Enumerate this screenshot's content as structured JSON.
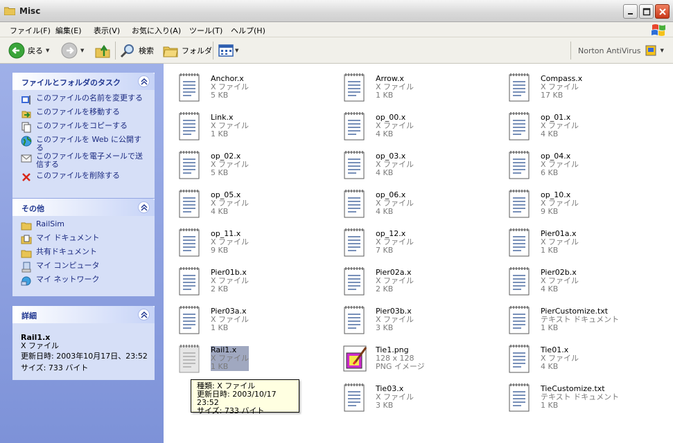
{
  "window": {
    "title": "Misc"
  },
  "menu": [
    "ファイル(F)",
    "編集(E)",
    "表示(V)",
    "お気に入り(A)",
    "ツール(T)",
    "ヘルプ(H)"
  ],
  "toolbar": {
    "back": "戻る",
    "search": "検索",
    "folders": "フォルダ",
    "norton": "Norton AntiVirus"
  },
  "tasks": {
    "title": "ファイルとフォルダのタスク",
    "items": [
      "このファイルの名前を変更する",
      "このファイルを移動する",
      "このファイルをコピーする",
      "このファイルを Web に公開する",
      "このファイルを電子メールで送信する",
      "このファイルを削除する"
    ]
  },
  "other": {
    "title": "その他",
    "items": [
      "RailSim",
      "マイ ドキュメント",
      "共有ドキュメント",
      "マイ コンピュータ",
      "マイ ネットワーク"
    ]
  },
  "details": {
    "title": "詳細",
    "name": "Rail1.x",
    "type": "X ファイル",
    "modified": "更新日時: 2003年10月17日、23:52",
    "size": "サイズ: 733 バイト"
  },
  "files": [
    {
      "name": "Anchor.x",
      "type": "X ファイル",
      "size": "5 KB"
    },
    {
      "name": "Arrow.x",
      "type": "X ファイル",
      "size": "1 KB"
    },
    {
      "name": "Compass.x",
      "type": "X ファイル",
      "size": "17 KB"
    },
    {
      "name": "Link.x",
      "type": "X ファイル",
      "size": "1 KB"
    },
    {
      "name": "op_00.x",
      "type": "X ファイル",
      "size": "4 KB"
    },
    {
      "name": "op_01.x",
      "type": "X ファイル",
      "size": "4 KB"
    },
    {
      "name": "op_02.x",
      "type": "X ファイル",
      "size": "5 KB"
    },
    {
      "name": "op_03.x",
      "type": "X ファイル",
      "size": "4 KB"
    },
    {
      "name": "op_04.x",
      "type": "X ファイル",
      "size": "6 KB"
    },
    {
      "name": "op_05.x",
      "type": "X ファイル",
      "size": "4 KB"
    },
    {
      "name": "op_06.x",
      "type": "X ファイル",
      "size": "4 KB"
    },
    {
      "name": "op_10.x",
      "type": "X ファイル",
      "size": "9 KB"
    },
    {
      "name": "op_11.x",
      "type": "X ファイル",
      "size": "9 KB"
    },
    {
      "name": "op_12.x",
      "type": "X ファイル",
      "size": "7 KB"
    },
    {
      "name": "Pier01a.x",
      "type": "X ファイル",
      "size": "1 KB"
    },
    {
      "name": "Pier01b.x",
      "type": "X ファイル",
      "size": "2 KB"
    },
    {
      "name": "Pier02a.x",
      "type": "X ファイル",
      "size": "2 KB"
    },
    {
      "name": "Pier02b.x",
      "type": "X ファイル",
      "size": "4 KB"
    },
    {
      "name": "Pier03a.x",
      "type": "X ファイル",
      "size": "1 KB"
    },
    {
      "name": "Pier03b.x",
      "type": "X ファイル",
      "size": "3 KB"
    },
    {
      "name": "PierCustomize.txt",
      "type": "テキスト ドキュメント",
      "size": "1 KB"
    },
    {
      "name": "Rail1.x",
      "type": "X ファイル",
      "size": "1 KB"
    },
    {
      "name": "Tie1.png",
      "type": "128 x 128",
      "size": "PNG イメージ"
    },
    {
      "name": "Tie01.x",
      "type": "X ファイル",
      "size": "4 KB"
    },
    {
      "name": "",
      "type": "",
      "size": ""
    },
    {
      "name": "Tie03.x",
      "type": "X ファイル",
      "size": "3 KB"
    },
    {
      "name": "TieCustomize.txt",
      "type": "テキスト ドキュメント",
      "size": "1 KB"
    }
  ],
  "tooltip": {
    "line1": "種類: X ファイル",
    "line2": "更新日時: 2003/10/17 23:52",
    "line3": "サイズ: 733 バイト"
  }
}
